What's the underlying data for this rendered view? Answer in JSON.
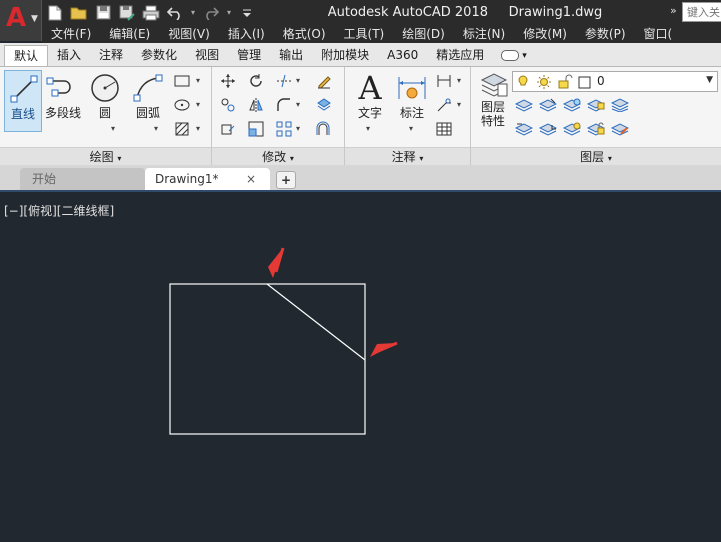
{
  "app": {
    "title": "Autodesk AutoCAD 2018",
    "document": "Drawing1.dwg",
    "logo_letter": "A",
    "search_placeholder": "键入关"
  },
  "menubar": [
    "文件(F)",
    "编辑(E)",
    "视图(V)",
    "插入(I)",
    "格式(O)",
    "工具(T)",
    "绘图(D)",
    "标注(N)",
    "修改(M)",
    "参数(P)",
    "窗口("
  ],
  "ribbon_tabs": [
    "默认",
    "插入",
    "注释",
    "参数化",
    "视图",
    "管理",
    "输出",
    "附加模块",
    "A360",
    "精选应用"
  ],
  "ribbon": {
    "draw": {
      "title": "绘图",
      "line": "直线",
      "polyline": "多段线",
      "circle": "圆",
      "arc": "圆弧"
    },
    "modify": {
      "title": "修改"
    },
    "annotation": {
      "title": "注释",
      "text": "文字",
      "dimension": "标注"
    },
    "layers": {
      "title": "图层",
      "properties_line1": "图层",
      "properties_line2": "特性",
      "current_layer": "0"
    }
  },
  "doc_tabs": {
    "start": "开始",
    "drawing": "Drawing1*",
    "close": "×",
    "add": "+"
  },
  "viewport": {
    "label": "[−][俯视][二维线框]"
  },
  "colors": {
    "canvas": "#212830",
    "line": "#ffffff",
    "arrow": "#e53935",
    "accent": "#d9282e"
  }
}
